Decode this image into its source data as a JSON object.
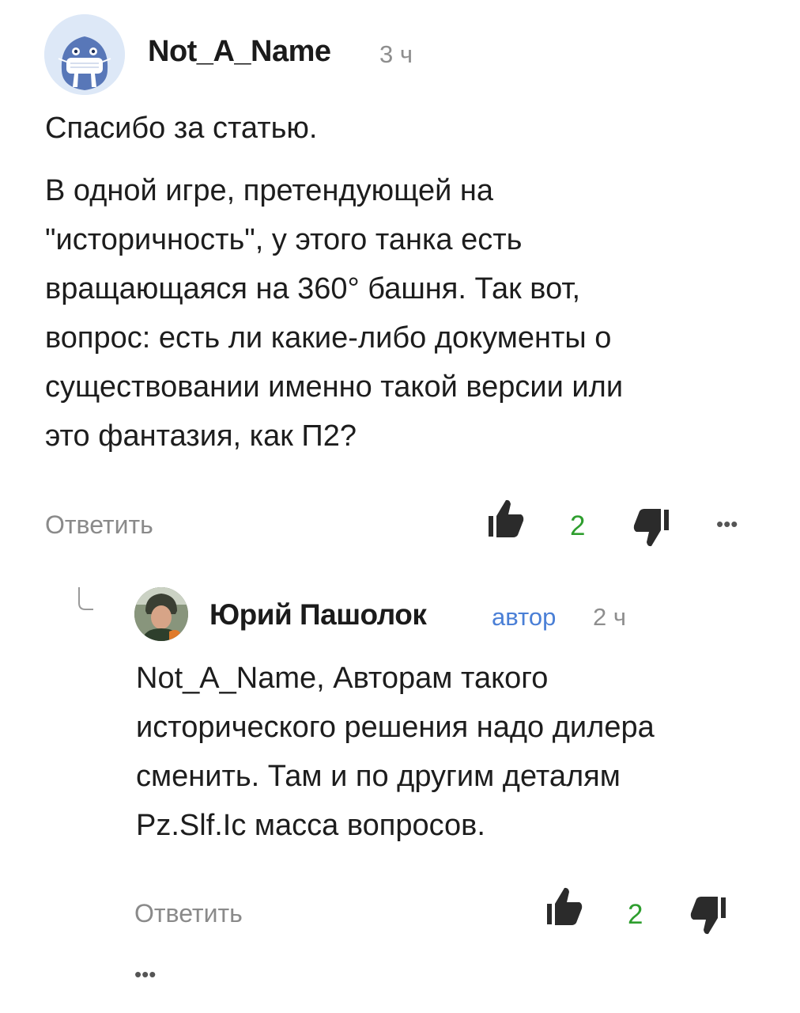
{
  "comment": {
    "author": "Not_A_Name",
    "time": "3 ч",
    "paragraph1": "Спасибо за статью.",
    "body_lines": [
      "В одной игре, претендующей на",
      "\"историчность\", у этого танка есть",
      "вращающаяся на 360° башня. Так вот,",
      "вопрос: есть ли какие-либо документы о",
      "существовании именно такой версии или",
      "это фантазия, как П2?"
    ],
    "reply_label": "Ответить",
    "likes": "2",
    "more": "•••"
  },
  "reply": {
    "author": "Юрий Пашолок",
    "badge": "автор",
    "time": "2 ч",
    "body_lines": [
      "Not_A_Name, Авторам такого",
      "исторического решения надо дилера",
      "сменить. Там и по другим деталям",
      "Pz.Slf.Ic масса вопросов."
    ],
    "reply_label": "Ответить",
    "likes": "2",
    "more": "•••"
  },
  "icons": {
    "avatar1": "walrus-mask-avatar",
    "avatar2": "user-photo-avatar",
    "like": "thumbs-up-icon",
    "dislike": "thumbs-down-icon",
    "more": "more-dots-icon",
    "thread": "reply-thread-line-icon"
  },
  "colors": {
    "likes": "#2e9e2e",
    "author_badge": "#4a7fd6",
    "muted": "#8a8a8a"
  }
}
